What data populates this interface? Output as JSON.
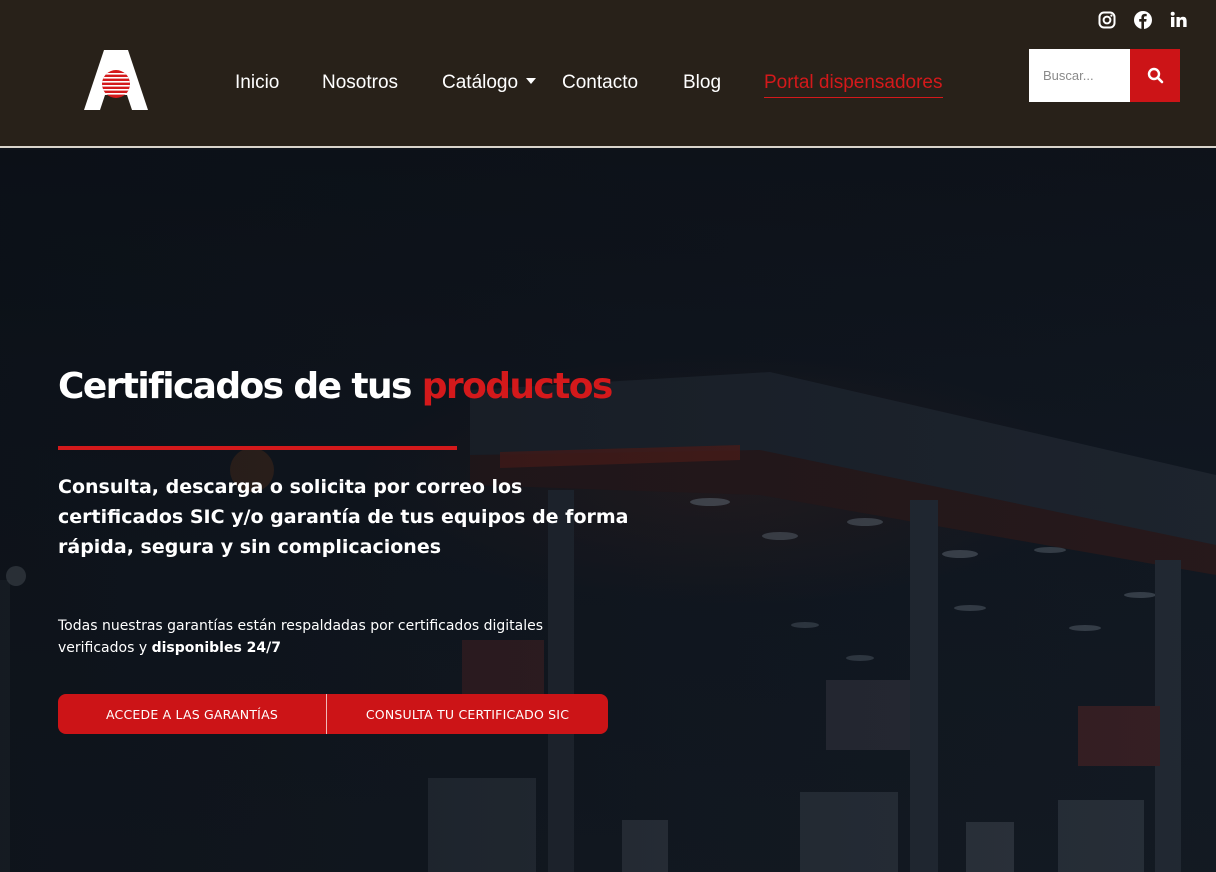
{
  "header": {
    "logo": {
      "icon": "brand-a-logo-icon",
      "colors": {
        "letter": "#ffffff",
        "emblem": "#d4191b"
      }
    },
    "nav": [
      {
        "label": "Inicio",
        "active": false
      },
      {
        "label": "Nosotros",
        "active": false
      },
      {
        "label": "Catálogo",
        "active": false,
        "has_dropdown": true
      },
      {
        "label": "Contacto",
        "active": false
      },
      {
        "label": "Blog",
        "active": false
      },
      {
        "label": "Portal dispensadores",
        "active": true
      }
    ],
    "social": [
      {
        "icon": "instagram-icon"
      },
      {
        "icon": "facebook-icon"
      },
      {
        "icon": "linkedin-icon"
      }
    ],
    "search": {
      "placeholder": "Buscar...",
      "value": "",
      "button_icon": "search-icon"
    }
  },
  "hero": {
    "title_main": "Certificados de tus",
    "title_accent": "productos",
    "subtitle": "Consulta, descarga o solicita por correo los certificados SIC y/o garantía de tus equipos de forma rápida, segura y sin complicaciones",
    "note_text": "Todas nuestras garantías están respaldadas por certificados digitales verificados y",
    "note_bold": "disponibles 24/7",
    "buttons": [
      {
        "label": "ACCEDE A LAS GARANTÍAS"
      },
      {
        "label": "CONSULTA TU CERTIFICADO SIC"
      }
    ],
    "background_image": "gas-station-at-night"
  },
  "colors": {
    "header_bg": "#282119",
    "accent": "#d4191b",
    "button_bg": "#cc1417",
    "hero_bg": "#111822",
    "text": "#ffffff"
  }
}
